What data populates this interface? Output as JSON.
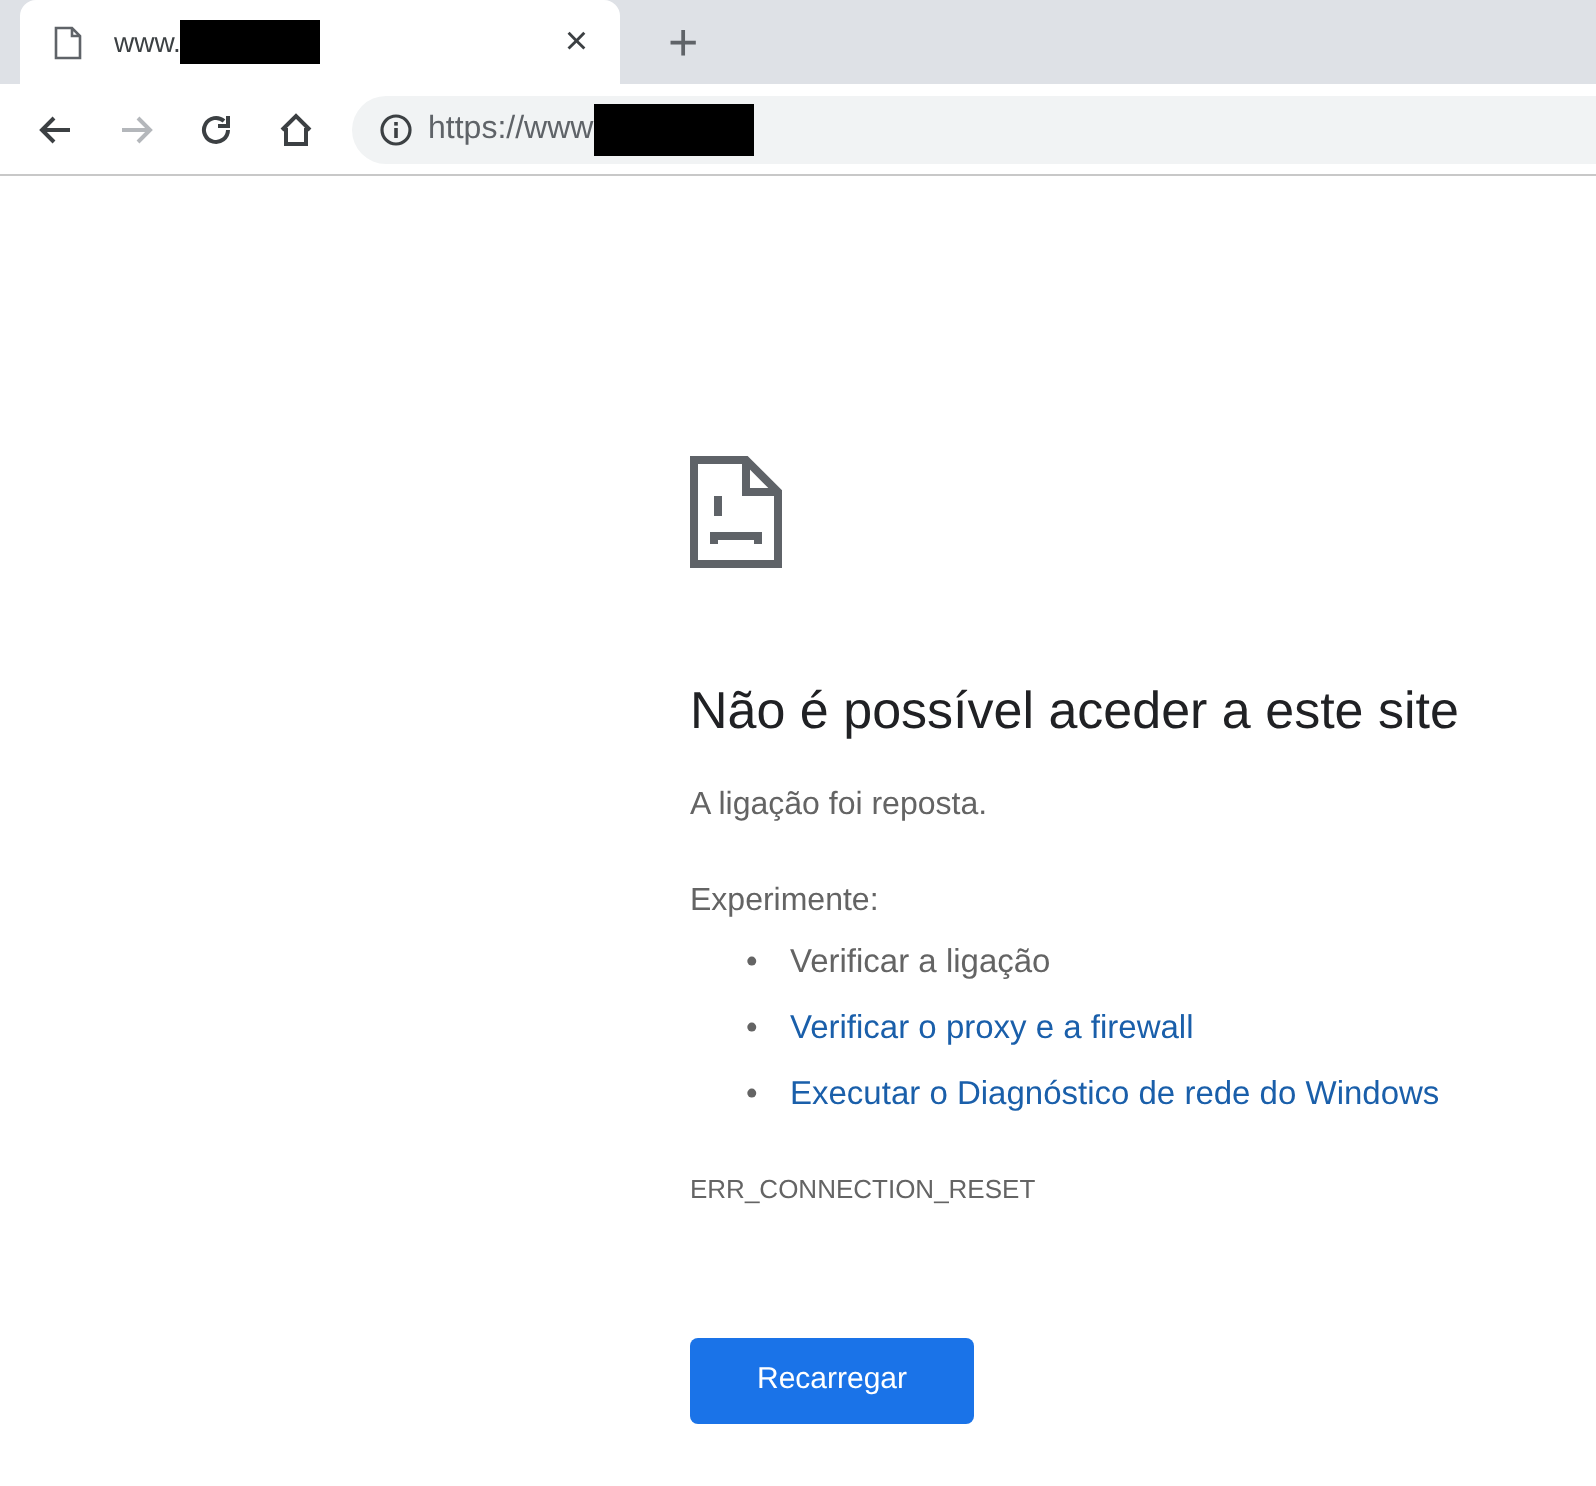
{
  "tab": {
    "title": "www.",
    "close": "×"
  },
  "new_tab": "+",
  "toolbar": [
    {
      "kind": "back",
      "disabled": false
    },
    {
      "kind": "forward",
      "disabled": true
    },
    {
      "kind": "reload",
      "disabled": false
    },
    {
      "kind": "home",
      "disabled": false
    }
  ],
  "address": {
    "value": "https://www"
  },
  "error": {
    "heading": "Não é possível aceder a este site",
    "message": "A ligação foi reposta.",
    "suggestions_label": "Experimente:",
    "suggestions": [
      {
        "kind": "text",
        "bullet": "•",
        "text": "Verificar a ligação"
      },
      {
        "kind": "link",
        "bullet": "•",
        "text": "Verificar o proxy e a firewall"
      },
      {
        "kind": "link",
        "bullet": "•",
        "text": "Executar o Diagnóstico de rede do Windows"
      }
    ],
    "code": "ERR_CONNECTION_RESET",
    "button": "Recarregar"
  }
}
